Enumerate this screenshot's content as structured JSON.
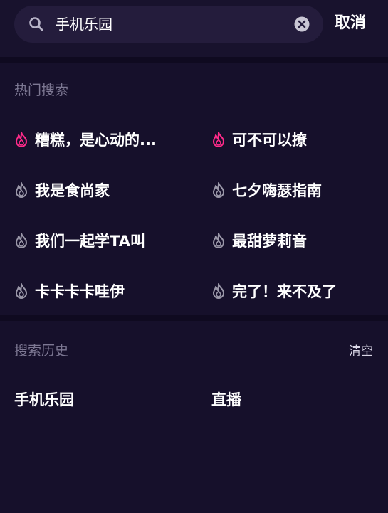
{
  "search": {
    "value": "手机乐园",
    "placeholder": "",
    "cancel_label": "取消"
  },
  "hot_search": {
    "title": "热门搜索",
    "items": [
      {
        "label": "糟糕，是心动的...",
        "highlighted": true
      },
      {
        "label": "可不可以撩",
        "highlighted": true
      },
      {
        "label": "我是食尚家",
        "highlighted": false
      },
      {
        "label": "七夕嗨瑟指南",
        "highlighted": false
      },
      {
        "label": "我们一起学TA叫",
        "highlighted": false
      },
      {
        "label": "最甜萝莉音",
        "highlighted": false
      },
      {
        "label": "卡卡卡卡哇伊",
        "highlighted": false
      },
      {
        "label": "完了！来不及了",
        "highlighted": false
      }
    ]
  },
  "history": {
    "title": "搜索历史",
    "clear_label": "清空",
    "items": [
      {
        "label": "手机乐园"
      },
      {
        "label": "直播"
      }
    ]
  },
  "colors": {
    "background": "#16102b",
    "search_box": "#241c3c",
    "hot_flame": "#ff2b8a",
    "normal_flame": "#9a97a8",
    "muted_text": "#7d7893"
  },
  "icons": {
    "search": "search-icon",
    "clear": "clear-icon",
    "flame": "flame-icon"
  }
}
